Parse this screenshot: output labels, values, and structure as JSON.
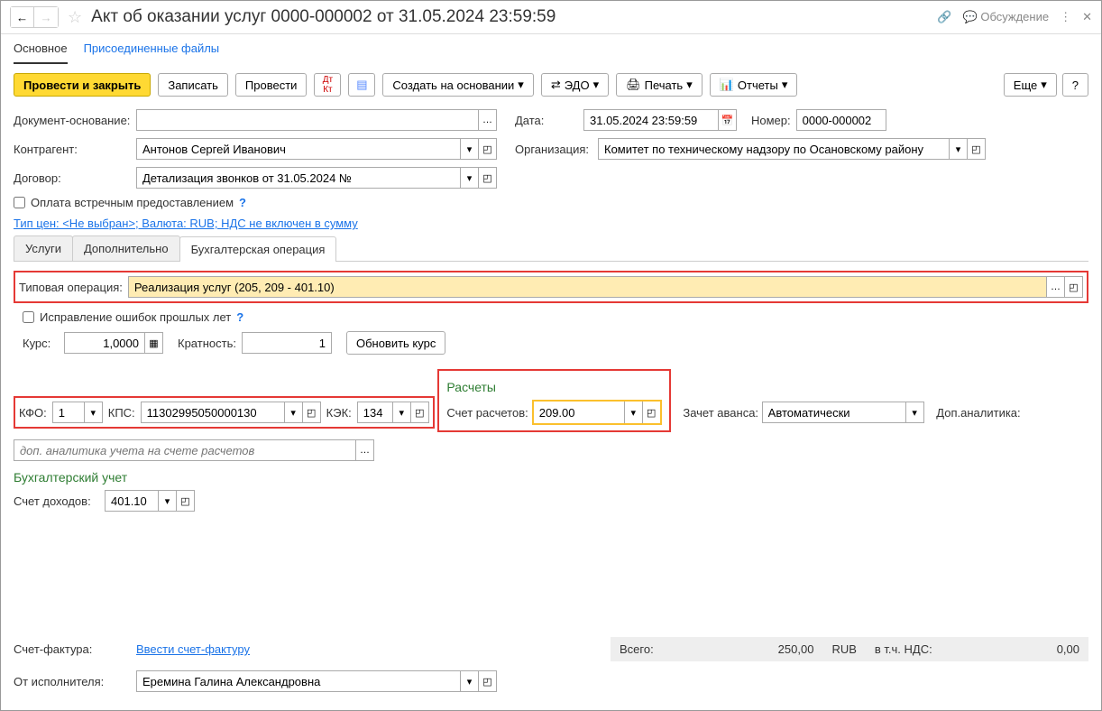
{
  "header": {
    "title": "Акт об оказании услуг 0000-000002 от 31.05.2024 23:59:59",
    "discuss": "Обсуждение"
  },
  "top_tabs": {
    "main": "Основное",
    "files": "Присоединенные файлы"
  },
  "toolbar": {
    "post_close": "Провести и закрыть",
    "save": "Записать",
    "post": "Провести",
    "create_based": "Создать на основании",
    "edo": "ЭДО",
    "print": "Печать",
    "reports": "Отчеты",
    "more": "Еще",
    "help": "?"
  },
  "fields": {
    "doc_base_label": "Документ-основание:",
    "doc_base": "",
    "date_label": "Дата:",
    "date": "31.05.2024 23:59:59",
    "number_label": "Номер:",
    "number": "0000-000002",
    "kontr_label": "Контрагент:",
    "kontr": "Антонов Сергей Иванович",
    "org_label": "Организация:",
    "org": "Комитет по техническому надзору по Осановскому району",
    "dogovor_label": "Договор:",
    "dogovor": "Детализация звонков от 31.05.2024 №",
    "counter_pay": "Оплата встречным предоставлением",
    "price_link": "Тип цен: <Не выбран>; Валюта: RUB; НДС не включен в сумму"
  },
  "inner_tabs": {
    "uslugi": "Услуги",
    "dop": "Дополнительно",
    "buh": "Бухгалтерская операция"
  },
  "buh": {
    "typop_label": "Типовая операция:",
    "typop": "Реализация услуг (205, 209 - 401.10)",
    "fix_errors": "Исправление ошибок прошлых лет",
    "kurs_label": "Курс:",
    "kurs": "1,0000",
    "krat_label": "Кратность:",
    "krat": "1",
    "update_kurs": "Обновить курс",
    "kfo_label": "КФО:",
    "kfo": "1",
    "kps_label": "КПС:",
    "kps": "11302995050000130",
    "kek_label": "КЭК:",
    "kek": "134",
    "raschety": "Расчеты",
    "schet_rasch_label": "Счет расчетов:",
    "schet_rasch": "209.00",
    "zachet_label": "Зачет аванса:",
    "zachet": "Автоматически",
    "dop_an_label": "Доп.аналитика:",
    "dop_an_ph": "доп. аналитика учета на счете расчетов",
    "buh_uchet": "Бухгалтерский учет",
    "schet_doh_label": "Счет доходов:",
    "schet_doh": "401.10"
  },
  "footer": {
    "sf_label": "Счет-фактура:",
    "sf_link": "Ввести счет-фактуру",
    "isp_label": "От исполнителя:",
    "isp": "Еремина Галина Александровна",
    "total_label": "Всего:",
    "total": "250,00",
    "cur": "RUB",
    "nds_label": "в т.ч. НДС:",
    "nds": "0,00"
  }
}
